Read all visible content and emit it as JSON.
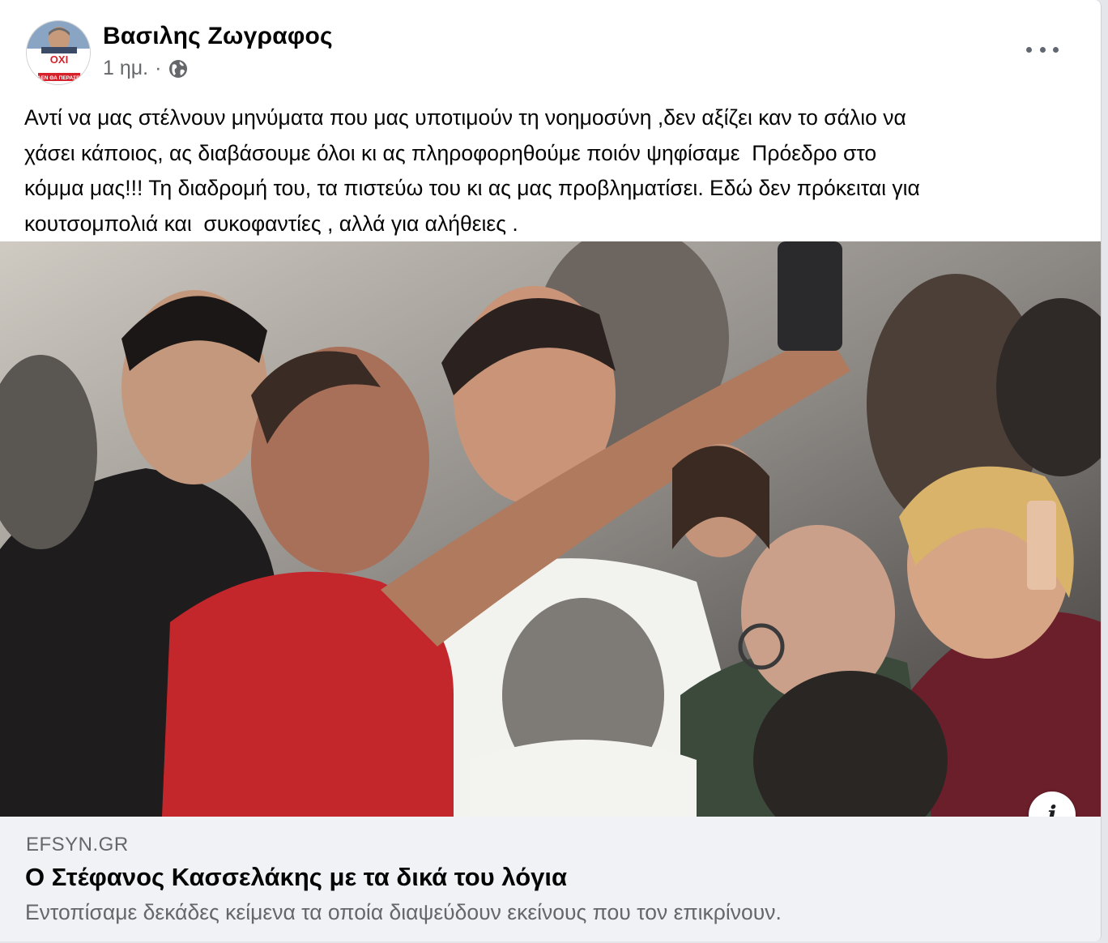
{
  "post": {
    "author": "Βασιλης Ζωγραφος",
    "time": "1 ημ.",
    "separator": "·",
    "audience_icon": "globe-icon",
    "more_icon": "more-options-icon",
    "avatar_badge": {
      "line1": "ΟΧΙ",
      "line2": "ΔΕΝ ΘΑ ΠΕΡΑΣΕΙ"
    },
    "text": "Αντί να μας στέλνουν μηνύματα που μας υποτιμούν τη νοημοσύνη ,δεν αξίζει καν το σάλιο να\nχάσει κάποιος, ας διαβάσουμε όλοι κι ας πληροφορηθούμε ποιόν ψηφίσαμε  Πρόεδρο στο\nκόμμα μας!!! Τη διαδρομή του, τα πιστεύω του κι ας μας προβληματίσει. Εδώ δεν πρόκειται για\nκουτσομπολιά και  συκοφαντίες , αλλά για αλήθειες ."
  },
  "link_preview": {
    "info_label": "i",
    "domain": "EFSYN.GR",
    "title": "Ο Στέφανος Κασσελάκης με τα δικά του λόγια",
    "description": "Εντοπίσαμε δεκάδες κείμενα τα οποία διαψεύδουν εκείνους που τον επικρίνουν."
  }
}
